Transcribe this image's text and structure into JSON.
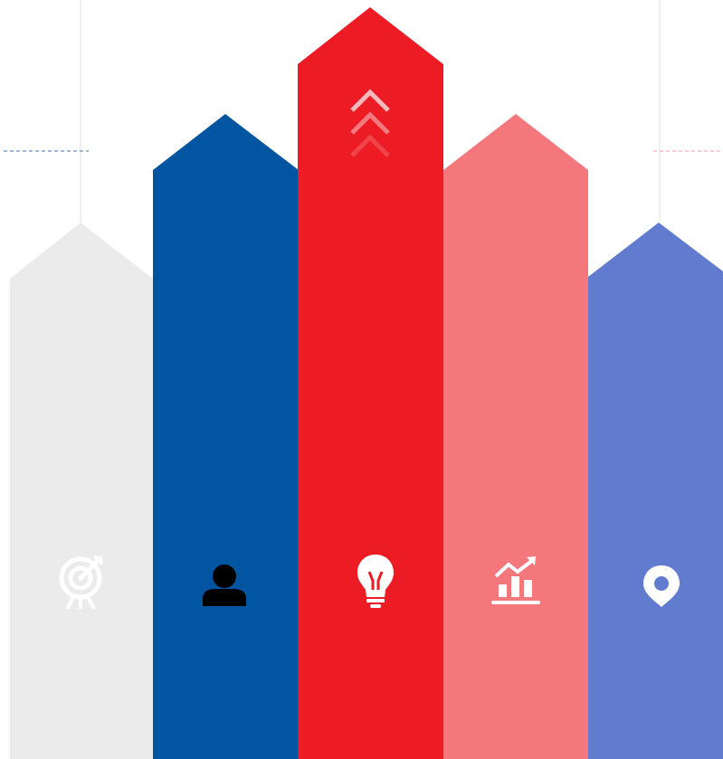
{
  "infographic": {
    "arrows": [
      {
        "id": "target",
        "color": "#ebebeb",
        "icon": "target-icon",
        "icon_color": "#ffffff"
      },
      {
        "id": "person",
        "color": "#0255a1",
        "icon": "person-icon",
        "icon_color": "#ffffff"
      },
      {
        "id": "idea",
        "color": "#ed1c24",
        "icon": "lightbulb-icon",
        "icon_color": "#ffffff"
      },
      {
        "id": "growth",
        "color": "#f4777c",
        "icon": "growth-chart-icon",
        "icon_color": "#ffffff"
      },
      {
        "id": "location",
        "color": "#617bcf",
        "icon": "location-pin-icon",
        "icon_color": "#ffffff"
      }
    ],
    "chevrons": {
      "icon": "chevron-up-icon",
      "colors": [
        "#f8b9bc",
        "#f37a7f",
        "#f0454b"
      ]
    },
    "guides": {
      "left_dash_color": "#4a73b5",
      "right_dash_color": "#f19ca0",
      "vertical_line_color": "#e0e0e0"
    }
  }
}
